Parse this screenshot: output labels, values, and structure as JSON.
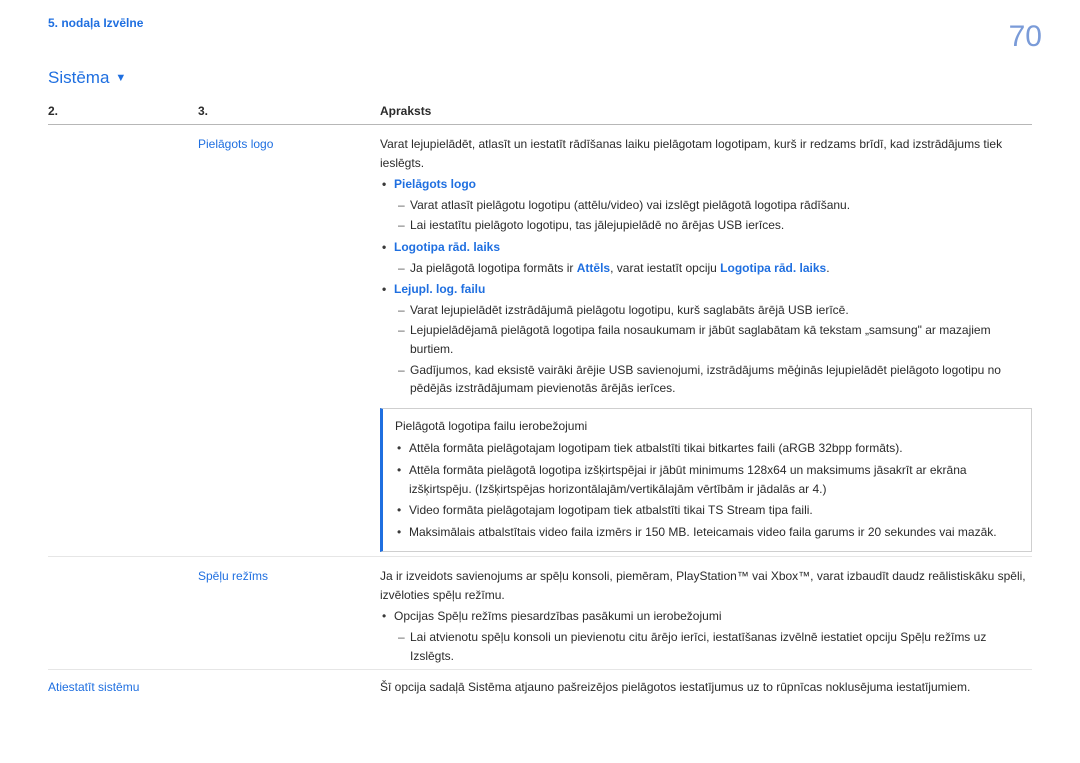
{
  "chapter": "5. nodaļa Izvēlne",
  "page_number": "70",
  "section_title": "Sistēma",
  "head": {
    "c1": "2.",
    "c2": "3.",
    "c3": "Apraksts"
  },
  "row_logo": {
    "label": "Pielāgots logo",
    "intro": "Varat lejupielādēt, atlasīt un iestatīt rādīšanas laiku pielāgotam logotipam, kurš ir redzams brīdī, kad izstrādājums tiek ieslēgts.",
    "b1": "Pielāgots logo",
    "b1s1": "Varat atlasīt pielāgotu logotipu (attēlu/video) vai izslēgt pielāgotā logotipa rādīšanu.",
    "b1s2": "Lai iestatītu pielāgoto logotipu, tas jālejupielādē no ārējas USB ierīces.",
    "b2": "Logotipa rād. laiks",
    "b2s1_pre": "Ja pielāgotā logotipa formāts ir ",
    "b2s1_term1": "Attēls",
    "b2s1_mid": ", varat iestatīt opciju ",
    "b2s1_term2": "Logotipa rād. laiks",
    "b2s1_post": ".",
    "b3": "Lejupl. log. failu",
    "b3s1": "Varat lejupielādēt izstrādājumā pielāgotu logotipu, kurš saglabāts ārējā USB ierīcē.",
    "b3s2": "Lejupielādējamā pielāgotā logotipa faila nosaukumam ir jābūt saglabātam kā tekstam „samsung\" ar mazajiem burtiem.",
    "b3s3": "Gadījumos, kad eksistē vairāki ārējie USB savienojumi, izstrādājums mēģinās lejupielādēt pielāgoto logotipu no pēdējās izstrādājumam pievienotās ārējās ierīces.",
    "callout_title": "Pielāgotā logotipa failu ierobežojumi",
    "c1": "Attēla formāta pielāgotajam logotipam tiek atbalstīti tikai bitkartes faili (aRGB 32bpp formāts).",
    "c2": "Attēla formāta pielāgotā logotipa izšķirtspējai ir jābūt minimums 128x64 un maksimums jāsakrīt ar ekrāna izšķirtspēju. (Izšķirtspējas horizontālajām/vertikālajām vērtībām ir jādalās ar 4.)",
    "c3": "Video formāta pielāgotajam logotipam tiek atbalstīti tikai TS Stream tipa faili.",
    "c4": "Maksimālais atbalstītais video faila izmērs ir 150 MB. Ieteicamais video faila garums ir 20 sekundes vai mazāk."
  },
  "row_game": {
    "label": "Spēļu režīms",
    "p1": "Ja ir izveidots savienojums ar spēļu konsoli, piemēram, PlayStation™ vai Xbox™, varat izbaudīt daudz reālistiskāku spēli, izvēloties spēļu režīmu.",
    "b1": "Opcijas Spēļu režīms piesardzības pasākumi un ierobežojumi",
    "b1s1": "Lai atvienotu spēļu konsoli un pievienotu citu ārējo ierīci, iestatīšanas izvēlnē iestatiet opciju Spēļu režīms uz Izslēgts."
  },
  "row_reset": {
    "label": "Atiestatīt sistēmu",
    "desc": "Šī opcija sadaļā Sistēma atjauno pašreizējos pielāgotos iestatījumus uz to rūpnīcas noklusējuma iestatījumiem."
  }
}
